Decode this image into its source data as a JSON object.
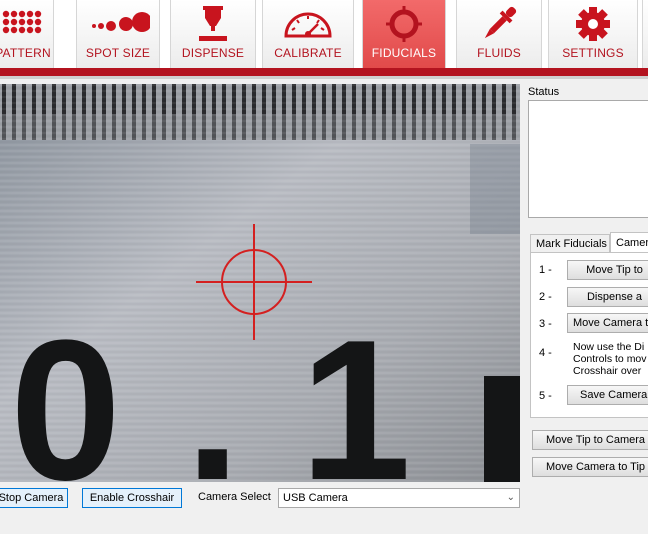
{
  "toolbar": {
    "items": [
      {
        "label": "PATTERN",
        "icon": "pattern-dots-icon",
        "active": false
      },
      {
        "label": "SPOT SIZE",
        "icon": "spot-size-icon",
        "active": false
      },
      {
        "label": "DISPENSE",
        "icon": "dispense-icon",
        "active": false
      },
      {
        "label": "CALIBRATE",
        "icon": "gauge-icon",
        "active": false
      },
      {
        "label": "FIDUCIALS",
        "icon": "crosshair-icon",
        "active": true
      },
      {
        "label": "FLUIDS",
        "icon": "dropper-icon",
        "active": false
      },
      {
        "label": "SETTINGS",
        "icon": "gear-icon",
        "active": false
      }
    ]
  },
  "colors": {
    "brand_red": "#b3131f",
    "active_tab": "#e85555",
    "crosshair": "#d42020"
  },
  "camera": {
    "scale_digits": [
      "0",
      ".",
      "1"
    ]
  },
  "status": {
    "label": "Status",
    "text": ""
  },
  "tabs": {
    "items": [
      "Mark Fiducials",
      "Camera"
    ],
    "active": 1
  },
  "steps": [
    {
      "num": "1 -",
      "button": "Move Tip to"
    },
    {
      "num": "2 -",
      "button": "Dispense a"
    },
    {
      "num": "3 -",
      "button": "Move Camera t"
    },
    {
      "num": "4 -",
      "text_lines": [
        "Now use the Di",
        "Controls to mov",
        "Crosshair over"
      ]
    },
    {
      "num": "5 -",
      "button": "Save Camera"
    }
  ],
  "actions": {
    "move_tip_to_camera": "Move Tip to Camera",
    "move_camera_to_tip": "Move Camera to Tip"
  },
  "bottom": {
    "stop_camera": "Stop Camera",
    "enable_crosshair": "Enable Crosshair",
    "camera_select_label": "Camera Select",
    "camera_select_value": "USB Camera"
  }
}
